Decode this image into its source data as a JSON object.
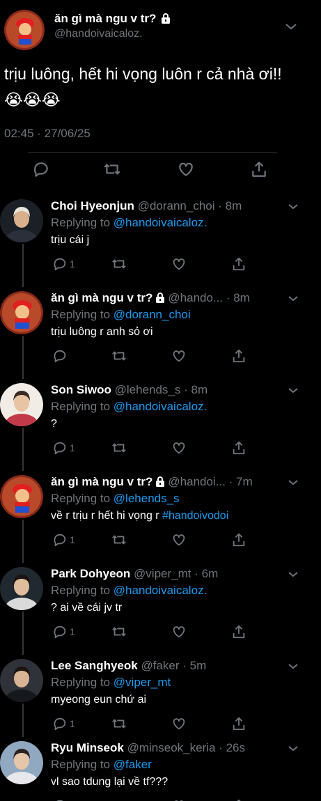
{
  "main_tweet": {
    "name": "ăn gì mà ngu v tr?",
    "handle": "@handoivaicaloz.",
    "text": "trịu luông, hết hi vọng luôn r cả nhà ơi!!😭😭😭",
    "timestamp": "02:45 · 27/06/25",
    "icons": [
      "lock-icon",
      "chevron-down-icon",
      "reply-icon",
      "retweet-icon",
      "like-icon",
      "share-icon"
    ]
  },
  "replies": [
    {
      "name": "Choi Hyeonjun",
      "handle": "@dorann_choi",
      "time": "8m",
      "replying_label": "Replying to",
      "replying_to": "@handoivaicaloz.",
      "text": "trịu cái j",
      "hashtag": "",
      "reply_count": "1",
      "locked": false
    },
    {
      "name": "ăn gì mà ngu v tr?",
      "handle": "@hando...",
      "time": "8m",
      "replying_label": "Replying to",
      "replying_to": "@dorann_choi",
      "text": "trịu luông r anh sỏ ơi",
      "hashtag": "",
      "reply_count": "",
      "locked": true
    },
    {
      "name": "Son Siwoo",
      "handle": "@lehends_s",
      "time": "8m",
      "replying_label": "Replying to",
      "replying_to": "@handoivaicaloz.",
      "text": "?",
      "hashtag": "",
      "reply_count": "1",
      "locked": false
    },
    {
      "name": "ăn gì mà ngu v tr?",
      "handle": "@handoi...",
      "time": "7m",
      "replying_label": "Replying to",
      "replying_to": "@lehends_s",
      "text": "về r trịu r hết hi vọng r ",
      "hashtag": "#handoivodoi",
      "reply_count": "1",
      "locked": true
    },
    {
      "name": "Park Dohyeon",
      "handle": "@viper_mt",
      "time": "6m",
      "replying_label": "Replying to",
      "replying_to": "@handoivaicaloz.",
      "text": "? ai về cái jv tr",
      "hashtag": "",
      "reply_count": "1",
      "locked": false
    },
    {
      "name": "Lee Sanghyeok",
      "handle": " @faker",
      "time": "5m",
      "replying_label": "Replying to",
      "replying_to": "@viper_mt",
      "text": "myeong eun chứ ai",
      "hashtag": "",
      "reply_count": "1",
      "locked": false
    },
    {
      "name": "Ryu Minseok",
      "handle": " @minseok_keria",
      "time": "26s",
      "replying_label": "Replying to",
      "replying_to": "@faker",
      "text": "vl sao tdung lại về tf???",
      "hashtag": "",
      "reply_count": "",
      "locked": false
    }
  ],
  "colors": {
    "background": "#000000",
    "text": "#e7e9ea",
    "muted": "#71767b",
    "link": "#1d9bf0",
    "divider": "#2f3336"
  }
}
